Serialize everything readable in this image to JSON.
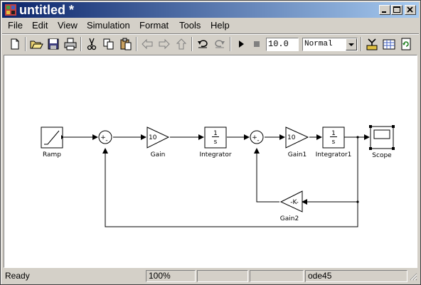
{
  "window": {
    "title": "untitled *",
    "controls": [
      "minimize",
      "maximize",
      "close"
    ]
  },
  "menu": [
    "File",
    "Edit",
    "View",
    "Simulation",
    "Format",
    "Tools",
    "Help"
  ],
  "toolbar": {
    "stop_time": "10.0",
    "sim_mode": "Normal",
    "tools": [
      "new-icon",
      "open-icon",
      "save-icon",
      "print-icon",
      "cut-icon",
      "copy-icon",
      "paste-icon",
      "back-icon",
      "forward-icon",
      "up-icon",
      "undo-icon",
      "redo-icon",
      "start-icon",
      "stop-icon",
      "library-browser-icon",
      "model-explorer-icon",
      "refresh-icon"
    ]
  },
  "model": {
    "blocks": {
      "ramp": "Ramp",
      "gain": "Gain",
      "gain_value": "10",
      "integrator": "Integrator",
      "gain1": "Gain1",
      "gain1_value": "10",
      "integrator1": "Integrator1",
      "scope": "Scope",
      "gain2": "Gain2",
      "gain2_value": "-K-",
      "int_num": "1",
      "int_den": "s",
      "sum_plus": "+",
      "sum_minus": "-"
    }
  },
  "status": {
    "state": "Ready",
    "zoom": "100%",
    "solver": "ode45"
  }
}
